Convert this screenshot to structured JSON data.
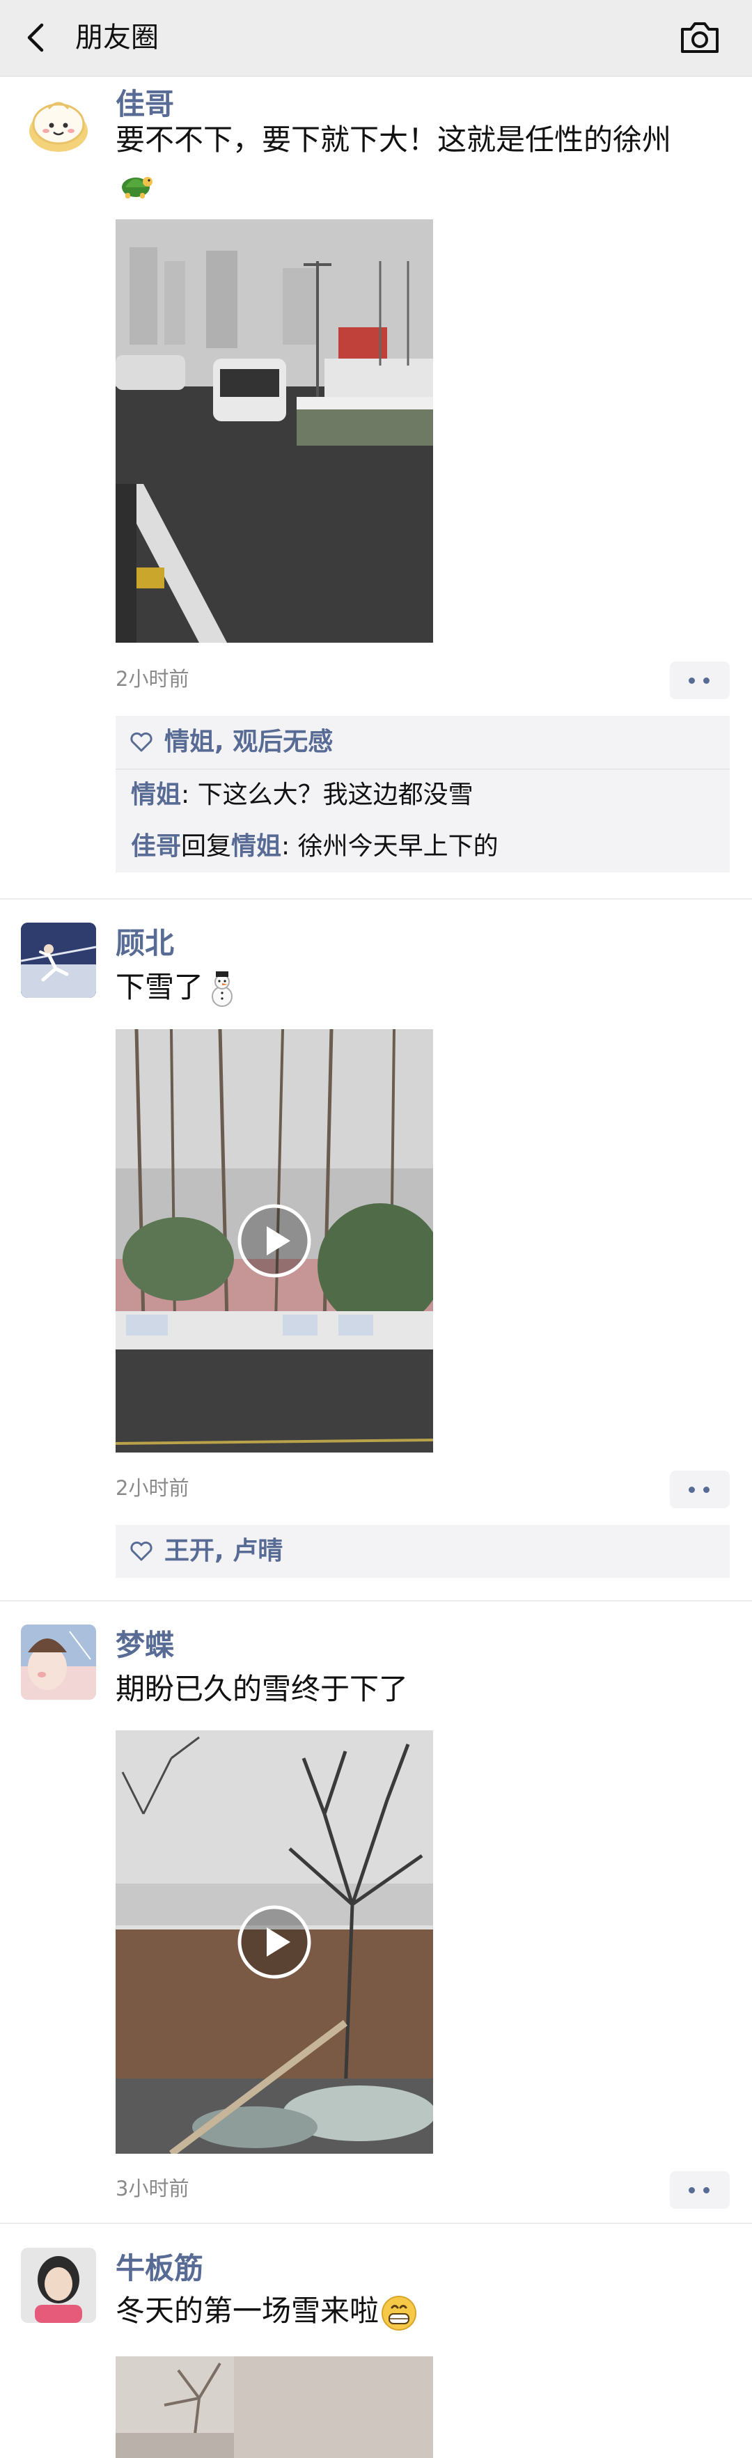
{
  "header": {
    "title": "朋友圈",
    "back_icon": "chevron-left-icon",
    "camera_icon": "camera-icon"
  },
  "posts": [
    {
      "author": "佳哥",
      "text": "要不不下，要下就下大！这就是任性的徐州",
      "emoji": "turtle",
      "time": "2小时前",
      "media": "photo",
      "likes": "情姐, 观后无感",
      "comments": [
        {
          "name": "情姐",
          "text": ": 下这么大？我这边都没雪"
        },
        {
          "name": "佳哥",
          "reply": "回复",
          "to": "情姐",
          "text": ": 徐州今天早上下的"
        }
      ]
    },
    {
      "author": "顾北",
      "text": "下雪了",
      "emoji": "snowman",
      "time": "2小时前",
      "media": "video",
      "likes": "王开, 卢晴"
    },
    {
      "author": "梦蝶",
      "text": "期盼已久的雪终于下了",
      "time": "3小时前",
      "media": "video"
    },
    {
      "author": "牛板筋",
      "text": "冬天的第一场雪来啦",
      "emoji": "grin"
    }
  ],
  "colors": {
    "name": "#576b95",
    "header_bg": "#ededed",
    "comment_bg": "#f3f3f5",
    "time": "#8a8a8a"
  }
}
